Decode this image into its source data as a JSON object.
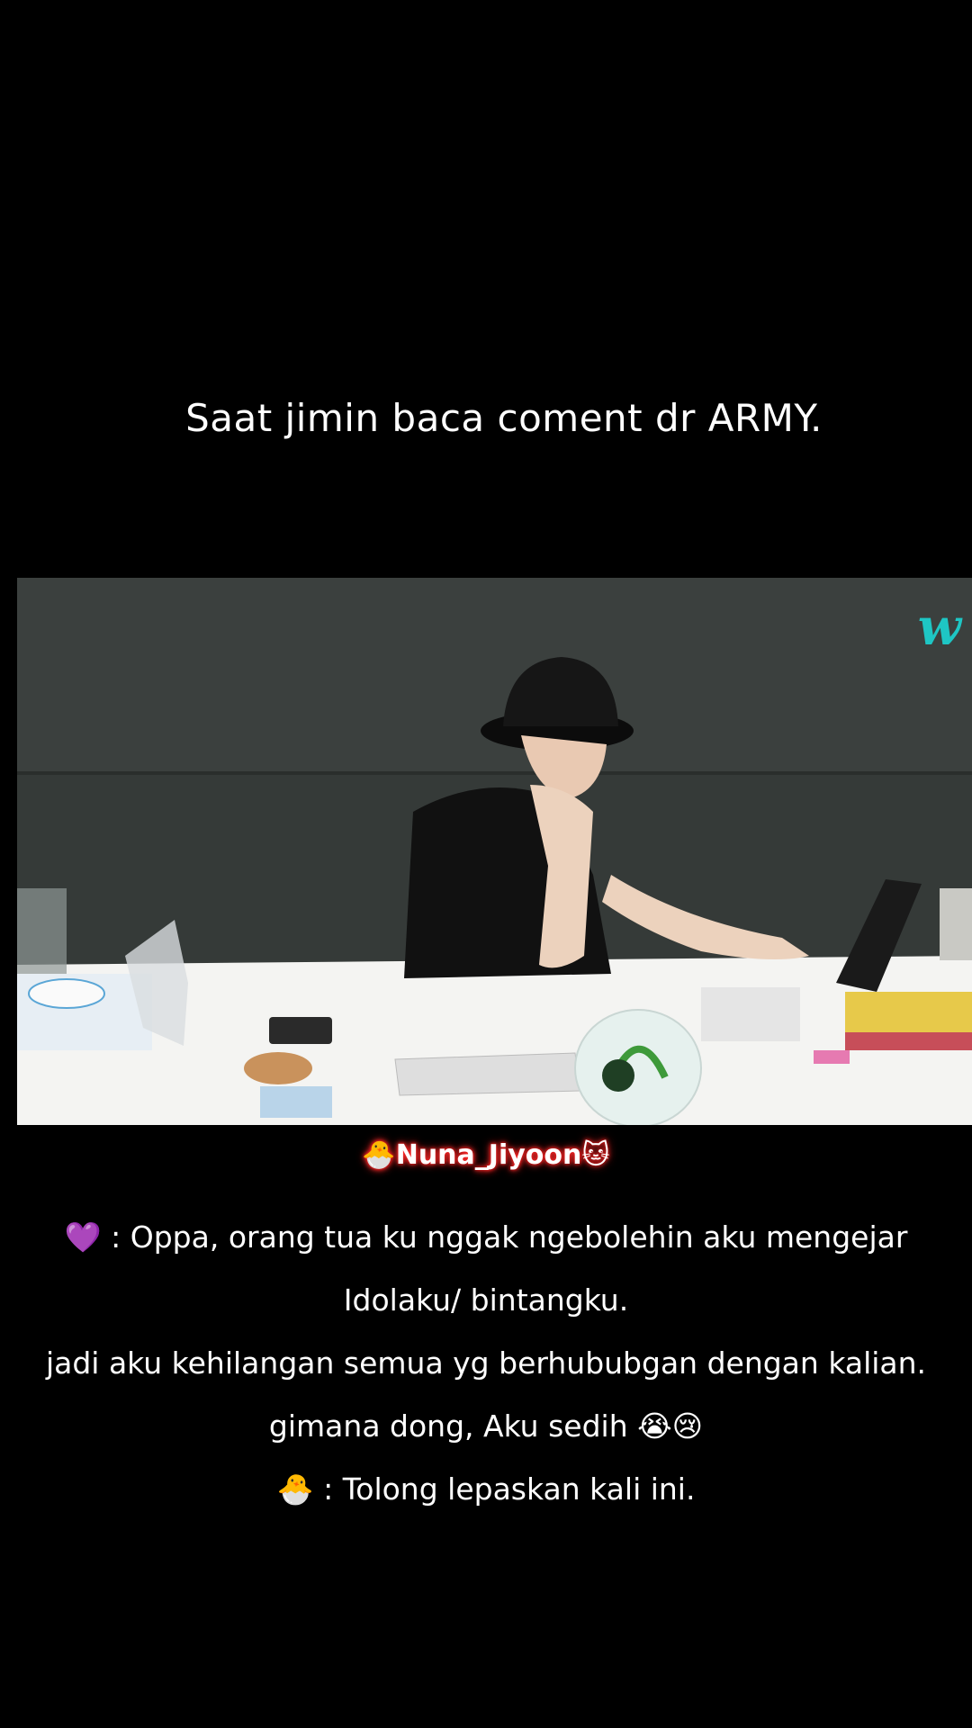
{
  "caption_top": "Saat jimin baca coment dr ARMY.",
  "video": {
    "watermark": "w"
  },
  "author": "🐣Nuna_Jiyoon🐱",
  "comment": {
    "lines": [
      "💜 : Oppa, orang tua ku nggak ngebolehin aku mengejar",
      "Idolaku/ bintangku.",
      "jadi aku kehilangan semua yg berhububgan dengan kalian.",
      "gimana dong, Aku sedih 😭😢",
      "🐣 : Tolong lepaskan kali ini."
    ]
  }
}
